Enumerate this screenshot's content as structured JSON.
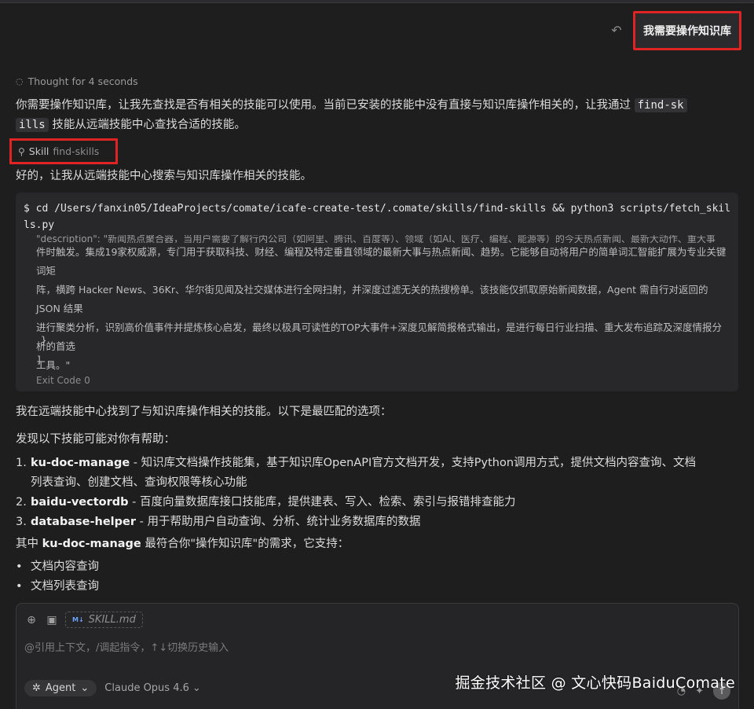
{
  "user_message": "我需要操作知识库",
  "thought": "Thought for 4 seconds",
  "intro_part1": "你需要操作知识库，让我先查找是否有相关的技能可以使用。当前已安装的技能中没有直接与知识库操作相关的，让我通过 ",
  "intro_code1": "find-sk",
  "intro_code2": "ills",
  "intro_part2": " 技能从远端技能中心查找合适的技能。",
  "skill": {
    "label": "Skill",
    "name": "find-skills"
  },
  "search_line": "好的，让我从远端技能中心搜索与知识库操作相关的技能。",
  "terminal": {
    "command": "$ cd /Users/fanxin05/IdeaProjects/comate/icafe-create-test/.comate/skills/find-skills && python3 scripts/fetch_skills.py",
    "output_clipped": "\"description\": \"新闻热点聚合器，当用户需要了解行内公司（如阿里、腾讯、百度等）、领域（如AI、医疗、编程、能源等）的今天热点新闻、最新大动作、重大事",
    "output_lines": [
      "件时触发。集成19家权威源，专门用于获取科技、财经、编程及特定垂直领域的最新大事与热点新闻、趋势。它能够自动将用户的简单词汇智能扩展为专业关键词矩",
      "阵，横跨 Hacker News、36Kr、华尔街见闻及社交媒体进行全网扫射，并深度过滤无关的热搜榜单。该技能仅抓取原始新闻数据，Agent 需自行对返回的 JSON 结果",
      "进行聚类分析，识别高价值事件并提炼核心启发，最终以极具可读性的TOP大事件+深度见解简报格式输出，是进行每日行业扫描、重大发布追踪及深度情报分析的首选",
      "工具。\""
    ],
    "brace": "}",
    "bracket": "]",
    "exit_code": "Exit Code 0"
  },
  "found_line": "我在远端技能中心找到了与知识库操作相关的技能。以下是最匹配的选项：",
  "discover_line": "发现以下技能可能对你有帮助：",
  "skills_list": [
    {
      "num": "1.",
      "name": "ku-doc-manage",
      "desc": " - 知识库文档操作技能集，基于知识库OpenAPI官方文档开发，支持Python调用方式，提供文档内容查询、文档",
      "desc2": "列表查询、创建文档、查询权限等核心功能"
    },
    {
      "num": "2.",
      "name": "baidu-vectordb",
      "desc": " - 百度向量数据库接口技能库，提供建表、写入、检索、索引与报错排查能力",
      "desc2": ""
    },
    {
      "num": "3.",
      "name": "database-helper",
      "desc": " - 用于帮助用户自动查询、分析、统计业务数据库的数据",
      "desc2": ""
    }
  ],
  "best_match": {
    "pre": "其中 ",
    "name": "ku-doc-manage",
    "post": " 最符合你\"操作知识库\"的需求，它支持："
  },
  "supports": [
    "文档内容查询",
    "文档列表查询"
  ],
  "composer": {
    "file_chip": "SKILL.md",
    "placeholder": "@引用上下文，/调起指令，↑↓切换历史输入",
    "agent_label": "Agent",
    "model_label": "Claude Opus 4.6"
  },
  "watermark": "掘金技术社区 @ 文心快码BaiduComate"
}
